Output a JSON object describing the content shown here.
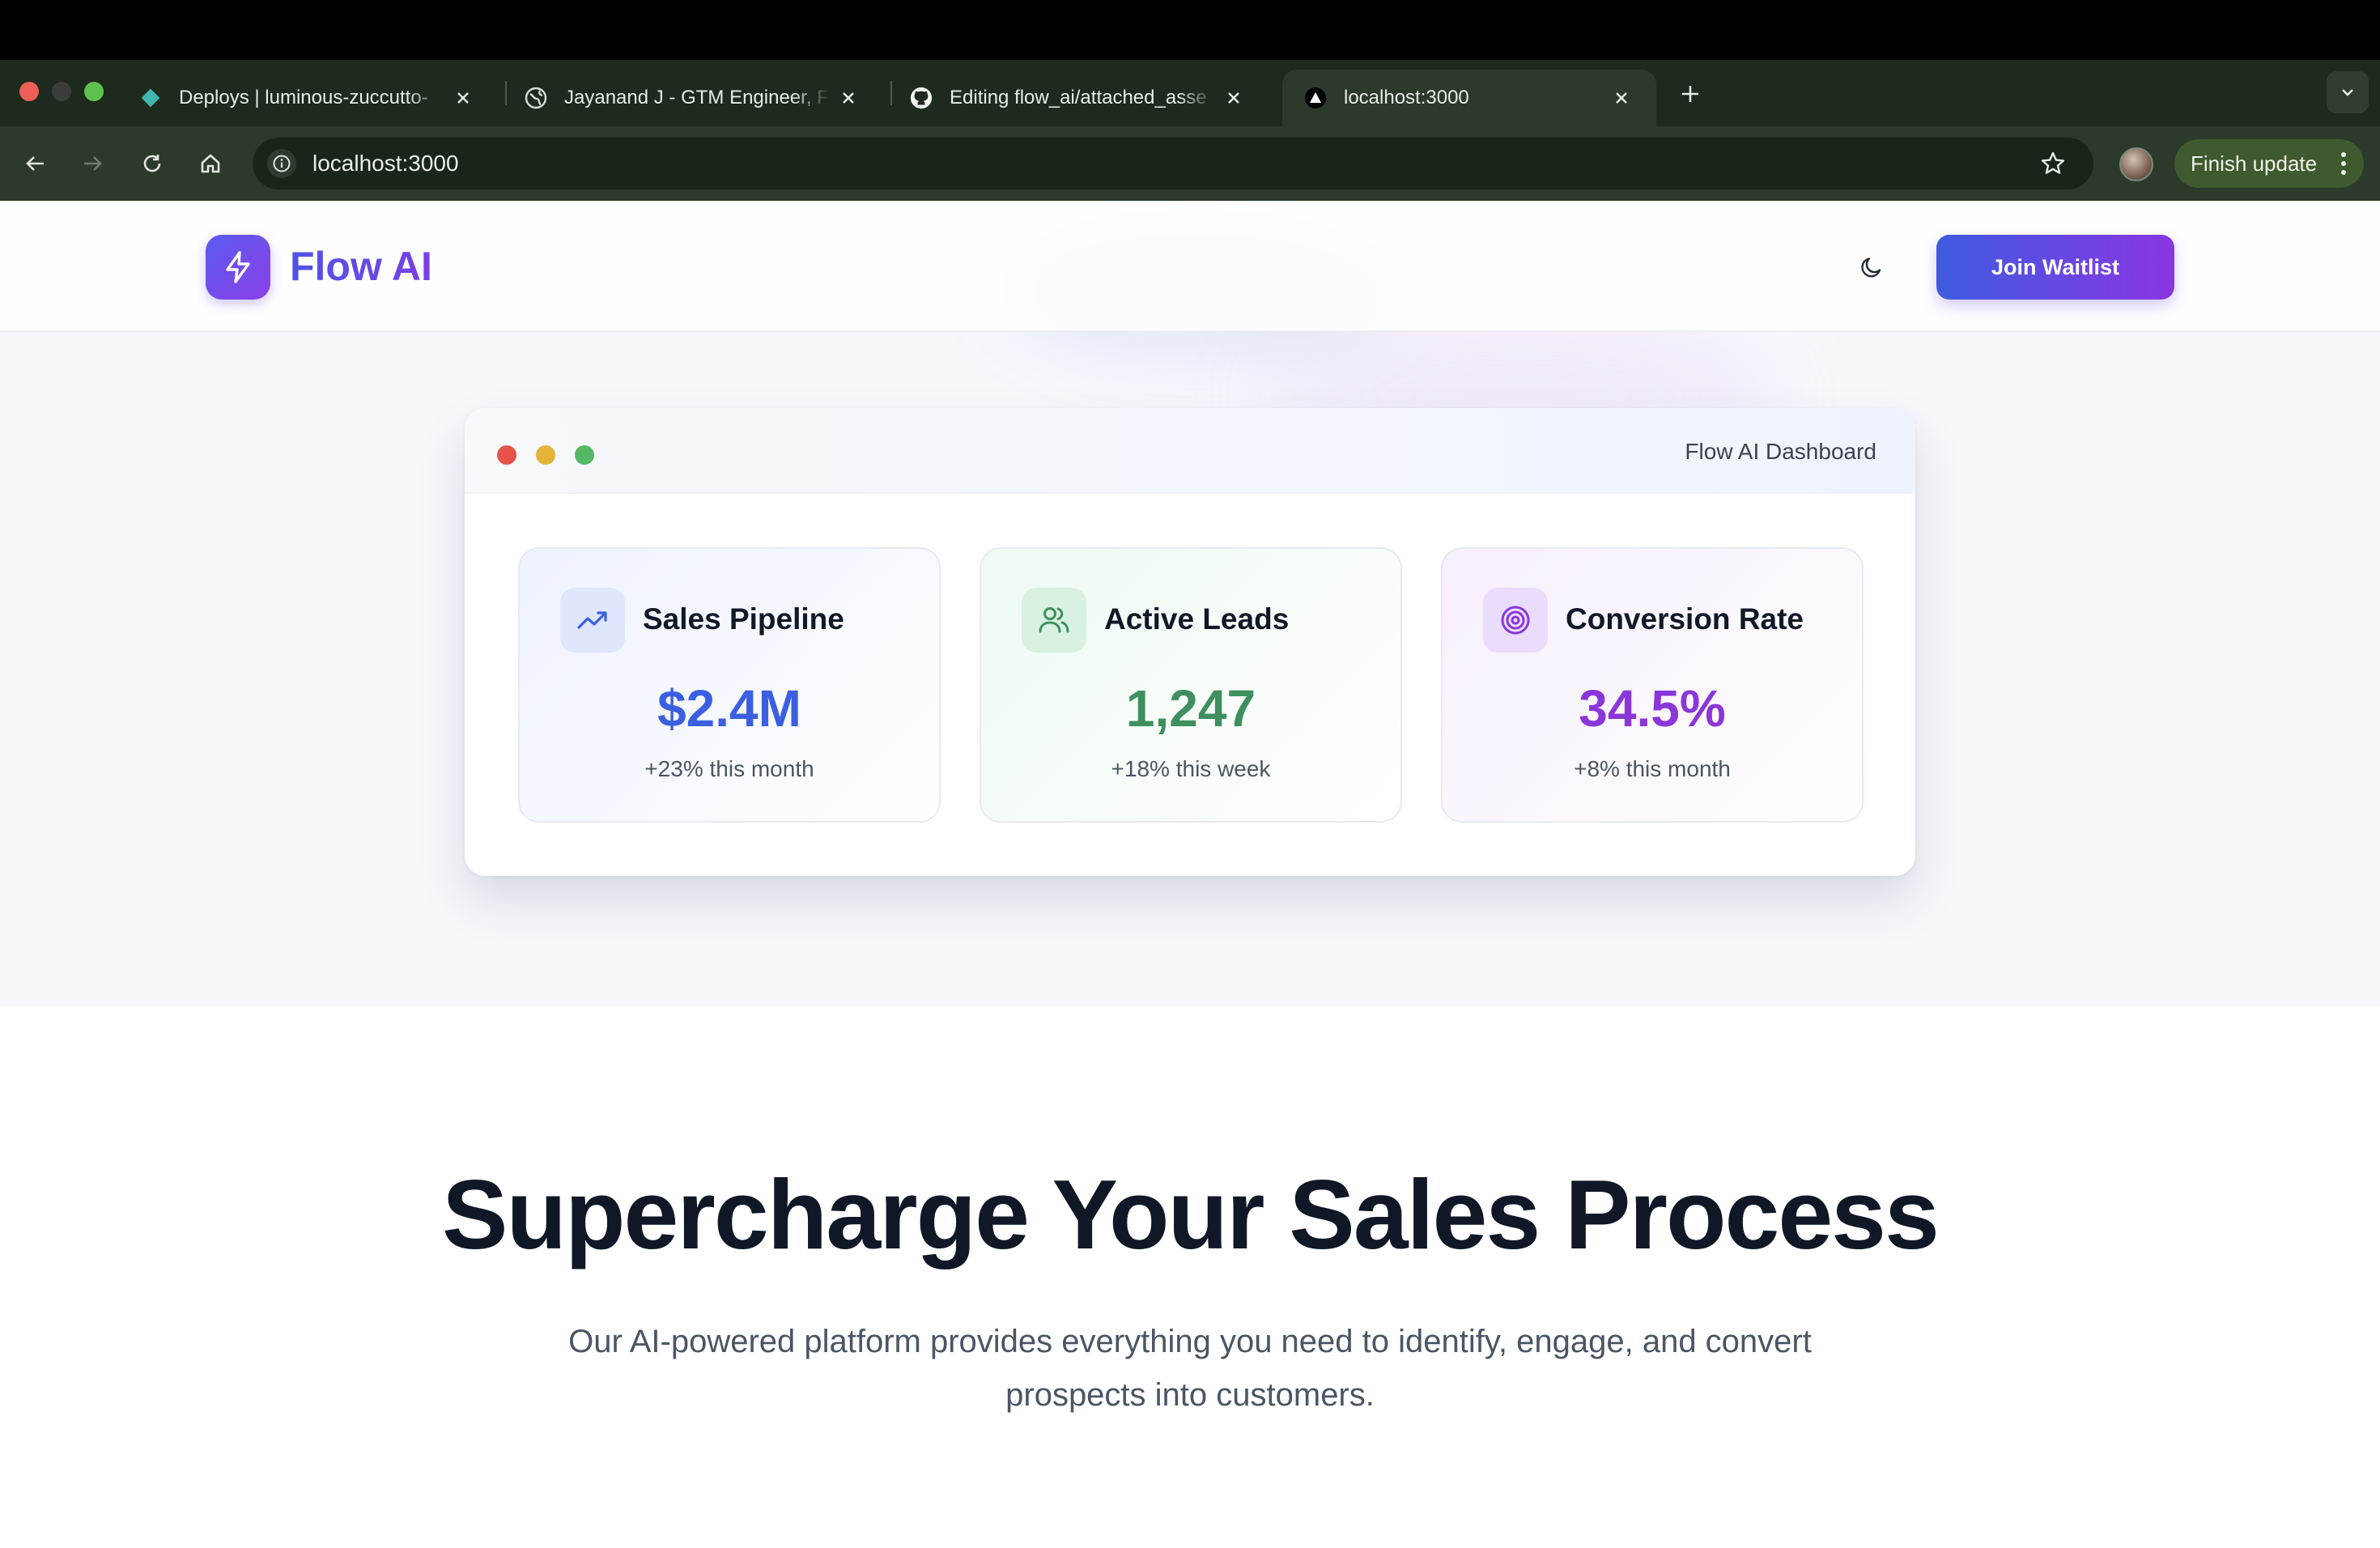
{
  "browser": {
    "tabs": [
      {
        "title": "Deploys | luminous-zuccutto-",
        "favicon": "netlify-diamond-icon"
      },
      {
        "title": "Jayanand J - GTM Engineer, F",
        "favicon": "globe-icon"
      },
      {
        "title": "Editing flow_ai/attached_asse",
        "favicon": "github-icon"
      },
      {
        "title": "localhost:3000",
        "favicon": "triangle-icon",
        "active": true
      }
    ],
    "url": "localhost:3000",
    "finish_update_label": "Finish update"
  },
  "header": {
    "brand": "Flow AI",
    "cta_label": "Join Waitlist"
  },
  "dashboard": {
    "title": "Flow AI Dashboard",
    "cards": [
      {
        "title": "Sales Pipeline",
        "value": "$2.4M",
        "change": "+23% this month",
        "icon": "trending-up-icon",
        "color": "#3b5fe0"
      },
      {
        "title": "Active Leads",
        "value": "1,247",
        "change": "+18% this week",
        "icon": "users-icon",
        "color": "#3f8f5f"
      },
      {
        "title": "Conversion Rate",
        "value": "34.5%",
        "change": "+8% this month",
        "icon": "target-icon",
        "color": "#8a36d8"
      }
    ]
  },
  "hero": {
    "headline": "Supercharge Your Sales Process",
    "subline": "Our AI-powered platform provides everything you need to identify, engage, and convert prospects into customers."
  }
}
